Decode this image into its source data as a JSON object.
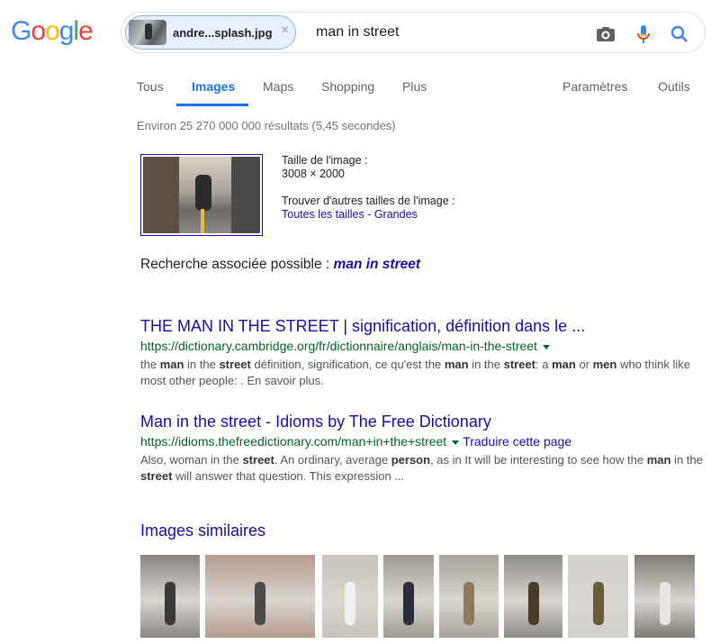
{
  "logo": "Google",
  "search": {
    "chip_label": "andre...splash.jpg",
    "chip_close": "×",
    "query": "man in street",
    "camera_icon": "camera-icon",
    "mic_icon": "microphone-icon",
    "search_icon": "search-icon"
  },
  "tabs": [
    {
      "label": "Tous"
    },
    {
      "label": "Images",
      "active": true
    },
    {
      "label": "Maps"
    },
    {
      "label": "Shopping"
    },
    {
      "label": "Plus"
    },
    {
      "label": "Paramètres"
    },
    {
      "label": "Outils"
    }
  ],
  "stats": "Environ 25 270 000 000 résultats (5,45 secondes)",
  "image_info": {
    "size_label": "Taille de l'image :",
    "size_value": "3008 × 2000",
    "other_sizes_label": "Trouver d'autres tailles de l'image :",
    "all_sizes_link": "Toutes les tailles",
    "separator": " - ",
    "large_link": "Grandes"
  },
  "related": {
    "label": "Recherche associée possible :",
    "link": "man in street"
  },
  "results": [
    {
      "title": "THE MAN IN THE STREET | signification, définition dans le ...",
      "url": "https://dictionary.cambridge.org/fr/dictionnaire/anglais/man-in-the-street",
      "snippet_parts": [
        {
          "t": "the ",
          "b": false
        },
        {
          "t": "man",
          "b": true
        },
        {
          "t": " in the ",
          "b": false
        },
        {
          "t": "street",
          "b": true
        },
        {
          "t": " définition, signification, ce qu'est the ",
          "b": false
        },
        {
          "t": "man",
          "b": true
        },
        {
          "t": " in the ",
          "b": false
        },
        {
          "t": "street",
          "b": true
        },
        {
          "t": ": a ",
          "b": false
        },
        {
          "t": "man",
          "b": true
        },
        {
          "t": " or ",
          "b": false
        },
        {
          "t": "men",
          "b": true
        },
        {
          "t": " who think like most other people: . En savoir plus.",
          "b": false
        }
      ]
    },
    {
      "title": "Man in the street - Idioms by The Free Dictionary",
      "url": "https://idioms.thefreedictionary.com/man+in+the+street",
      "translate": "Traduire cette page",
      "snippet_parts": [
        {
          "t": "Also, woman in the ",
          "b": false
        },
        {
          "t": "street",
          "b": true
        },
        {
          "t": ". An ordinary, average ",
          "b": false
        },
        {
          "t": "person",
          "b": true
        },
        {
          "t": ", as in It will be interesting to see how the ",
          "b": false
        },
        {
          "t": "man",
          "b": true
        },
        {
          "t": " in the ",
          "b": false
        },
        {
          "t": "street",
          "b": true
        },
        {
          "t": " will answer that question. This expression ...",
          "b": false
        }
      ]
    }
  ],
  "similar_title": "Images similaires",
  "similar_images": [
    {
      "name": "similar-image-1",
      "bg": "#8a8580",
      "fg": "#3a3a3a"
    },
    {
      "name": "similar-image-2",
      "bg": "#b59a8c",
      "fg": "#4a4a4a"
    },
    {
      "name": "similar-image-3",
      "bg": "#c7c2ba",
      "fg": "#efefef"
    },
    {
      "name": "similar-image-4",
      "bg": "#9f9a93",
      "fg": "#2a2e3a"
    },
    {
      "name": "similar-image-5",
      "bg": "#a8a49c",
      "fg": "#8c7a5c"
    },
    {
      "name": "similar-image-6",
      "bg": "#8e8c88",
      "fg": "#4a3a2a"
    },
    {
      "name": "similar-image-7",
      "bg": "#d2d0cc",
      "fg": "#6b5a3a"
    },
    {
      "name": "similar-image-8",
      "bg": "#7e7a74",
      "fg": "#e8e6e2"
    }
  ]
}
